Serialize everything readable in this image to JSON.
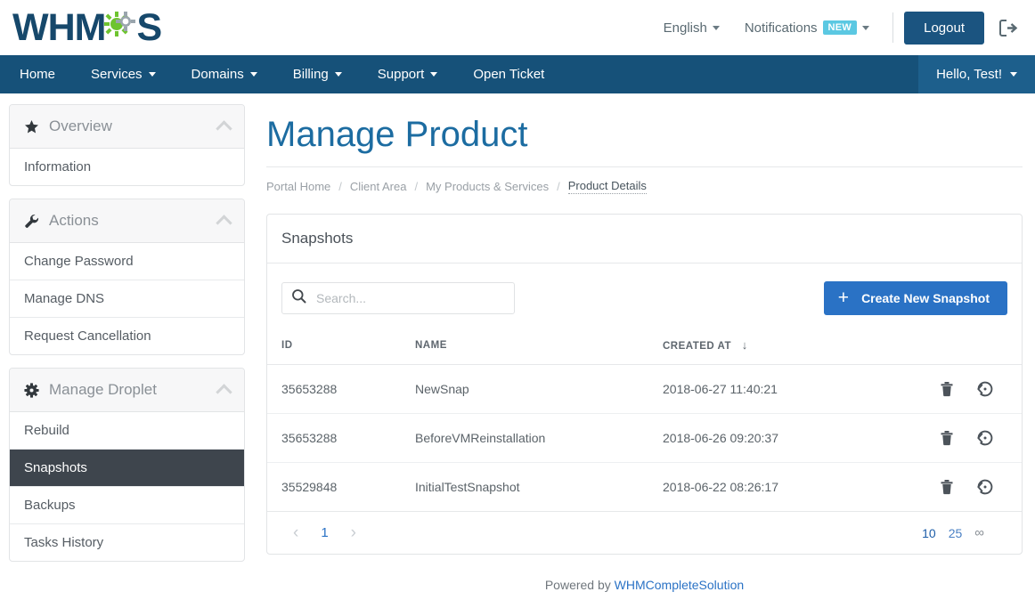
{
  "brand": {
    "logo_text_left": "WHM",
    "logo_text_right": "S",
    "primary_dark": "#16486b",
    "nav_blue": "#165179",
    "accent_blue": "#2a72c5",
    "gear_green": "#6ec42f"
  },
  "header": {
    "language_label": "English",
    "notifications_label": "Notifications",
    "notifications_badge": "NEW",
    "logout_label": "Logout",
    "logout_icon": "sign-out-icon"
  },
  "nav": {
    "items": [
      {
        "label": "Home",
        "has_caret": false
      },
      {
        "label": "Services",
        "has_caret": true
      },
      {
        "label": "Domains",
        "has_caret": true
      },
      {
        "label": "Billing",
        "has_caret": true
      },
      {
        "label": "Support",
        "has_caret": true
      },
      {
        "label": "Open Ticket",
        "has_caret": false
      }
    ],
    "user_label": "Hello, Test!"
  },
  "sidebar": {
    "panels": [
      {
        "title": "Overview",
        "icon": "star-icon",
        "items": [
          {
            "label": "Information",
            "active": false
          }
        ]
      },
      {
        "title": "Actions",
        "icon": "wrench-icon",
        "items": [
          {
            "label": "Change Password",
            "active": false
          },
          {
            "label": "Manage DNS",
            "active": false
          },
          {
            "label": "Request Cancellation",
            "active": false
          }
        ]
      },
      {
        "title": "Manage Droplet",
        "icon": "gear-icon",
        "items": [
          {
            "label": "Rebuild",
            "active": false
          },
          {
            "label": "Snapshots",
            "active": true
          },
          {
            "label": "Backups",
            "active": false
          },
          {
            "label": "Tasks History",
            "active": false
          }
        ]
      }
    ]
  },
  "main": {
    "page_title": "Manage Product",
    "breadcrumb": [
      {
        "label": "Portal Home",
        "current": false
      },
      {
        "label": "Client Area",
        "current": false
      },
      {
        "label": "My Products & Services",
        "current": false
      },
      {
        "label": "Product Details",
        "current": true
      }
    ],
    "breadcrumb_separator": "/",
    "card_title": "Snapshots",
    "search": {
      "placeholder": "Search...",
      "value": "",
      "icon": "search-icon"
    },
    "create_button": {
      "label": "Create New Snapshot",
      "icon": "plus-icon"
    },
    "table": {
      "columns": [
        "ID",
        "NAME",
        "CREATED AT"
      ],
      "sort_column": "CREATED AT",
      "sort_direction": "↓",
      "row_actions": [
        "trash-icon",
        "restore-icon"
      ],
      "rows": [
        {
          "id": "35653288",
          "name": "NewSnap",
          "created_at": "2018-06-27 11:40:21"
        },
        {
          "id": "35653288",
          "name": "BeforeVMReinstallation",
          "created_at": "2018-06-26 09:20:37"
        },
        {
          "id": "35529848",
          "name": "InitialTestSnapshot",
          "created_at": "2018-06-22 08:26:17"
        }
      ]
    },
    "pagination": {
      "prev_icon": "chevron-left-icon",
      "next_icon": "chevron-right-icon",
      "pages": [
        "1"
      ],
      "current_page": "1",
      "page_sizes": [
        {
          "label": "10",
          "selected": true
        },
        {
          "label": "25",
          "selected": false
        },
        {
          "label": "∞",
          "selected": false
        }
      ]
    }
  },
  "footer": {
    "prefix": "Powered by ",
    "link_label": "WHMCompleteSolution"
  }
}
